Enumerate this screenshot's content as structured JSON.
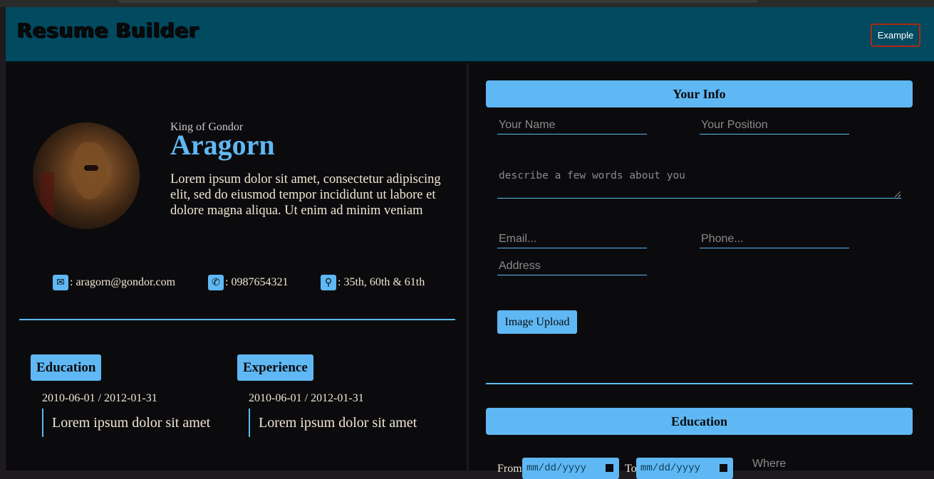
{
  "header": {
    "title": "Resume Builder",
    "example_label": "Example"
  },
  "preview": {
    "position": "King of Gondor",
    "name": "Aragorn",
    "about": "Lorem ipsum dolor sit amet, consectetur adipiscing elit, sed do eiusmod tempor incididunt ut labore et dolore magna aliqua. Ut enim ad minim veniam",
    "email": ": aragorn@gondor.com",
    "phone": ": 0987654321",
    "address": ": 35th, 60th & 61th",
    "education": {
      "heading": "Education",
      "dates": "2010-06-01 / 2012-01-31",
      "text": "Lorem ipsum dolor sit amet"
    },
    "experience": {
      "heading": "Experience",
      "dates": "2010-06-01 / 2012-01-31",
      "text": "Lorem ipsum dolor sit amet"
    }
  },
  "form": {
    "info_heading": "Your Info",
    "name_placeholder": "Your Name",
    "position_placeholder": "Your Position",
    "about_placeholder": "describe a few words about you",
    "email_placeholder": "Email...",
    "phone_placeholder": "Phone...",
    "address_placeholder": "Address",
    "upload_label": "Image Upload",
    "education_heading": "Education",
    "from_label": "From",
    "to_label": "To",
    "date_placeholder": "mm/dd/yyyy",
    "where_placeholder": "Where"
  },
  "colors": {
    "accent": "#5fb8f3",
    "header_bg": "#014a60",
    "page_bg": "#0b0b0e",
    "example_border": "#b02a10"
  },
  "icons": [
    "envelope-icon",
    "phone-icon",
    "location-pin-icon",
    "calendar-icon"
  ]
}
